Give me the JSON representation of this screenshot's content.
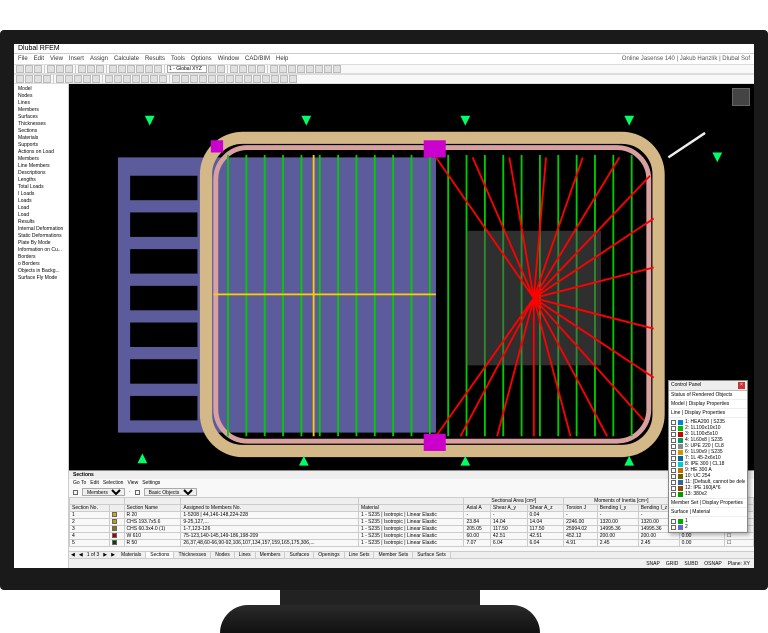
{
  "title": "Dlubal RFEM",
  "menu": [
    "File",
    "Edit",
    "View",
    "Insert",
    "Assign",
    "Calculate",
    "Results",
    "Tools",
    "Options",
    "Window",
    "CAD/BIM",
    "Help"
  ],
  "online": "Online Jasense 140 | Jakub Hanzlík | Dlubal Sof",
  "toolbar_fields": {
    "coord": "1 - Global XYZ"
  },
  "tree": {
    "items": [
      "Model",
      "Nodes",
      "Lines",
      "Members",
      "Surfaces",
      "Thicknesses",
      "Sections",
      "Materials",
      "Supports",
      "Actions on Load",
      "",
      "",
      "Members",
      "Line Members",
      "Descriptions",
      "Lengths",
      "",
      "",
      "Total Loads",
      "I Loads",
      "Loads",
      "Load",
      "Load",
      "Results",
      "Internal Deformation",
      "Static Deformations",
      "Plate By Mode",
      "",
      "",
      "",
      "Information on Cu...",
      "",
      "",
      "",
      "Borders",
      "o Borders",
      "",
      "Objects in Backg...",
      "Surface Fly Mode"
    ]
  },
  "sections_panel": {
    "title": "Sections",
    "toolbar_labels": [
      "Go To",
      "Edit",
      "Selection",
      "View",
      "Settings"
    ],
    "dropdown": "Members",
    "dropdown2": "Basic Objects",
    "group_headers": [
      "",
      "",
      "",
      "",
      "Sectional Area [cm²]",
      "",
      "Moments of Inertia [cm⁴]",
      "Principal Axis",
      ""
    ],
    "columns": [
      "Section No.",
      "",
      "Section Name",
      "Assigned to Members No.",
      "Material",
      "Axial A",
      "Shear A_y",
      "Shear A_z",
      "Torsion J",
      "Bending I_y",
      "Bending I_z",
      "α [deg]",
      "Options"
    ],
    "rows": [
      {
        "no": "1",
        "color": "#d4aa00",
        "name": "R 20",
        "assigned": "1-5208 | 44,146-148,224-228",
        "material": "1 - S235 | Isotropic | Linear Elastic",
        "A": "-",
        "Ay": "-",
        "Az": "0.04",
        "J": "-",
        "Iy": "-",
        "Iz": "-",
        "ang": "0.00",
        "opt": "☐"
      },
      {
        "no": "2",
        "color": "#c89800",
        "name": "CHS 193.7x5.6",
        "assigned": "9-25,127,...",
        "material": "1 - S235 | Isotropic | Linear Elastic",
        "A": "23.84",
        "Ay": "14.04",
        "Az": "14.04",
        "J": "2246.00",
        "Iy": "1320.00",
        "Iz": "1320.00",
        "ang": "0.00",
        "opt": "☐"
      },
      {
        "no": "3",
        "color": "#8b6f00",
        "name": "CHS 60.3x4.0 (1)",
        "assigned": "1-7,123-126",
        "material": "1 - S235 | Isotropic | Linear Elastic",
        "A": "205.05",
        "Ay": "117.50",
        "Az": "117.50",
        "J": "25994.02",
        "Iy": "14995.36",
        "Iz": "14995.36",
        "ang": "0.00",
        "opt": "☐"
      },
      {
        "no": "4",
        "color": "#aa0000",
        "name": "W 610",
        "assigned": "75-123,140-145,149-186,198-209",
        "material": "1 - S235 | Isotropic | Linear Elastic",
        "A": "60.00",
        "Ay": "42.51",
        "Az": "42.51",
        "J": "452.12",
        "Iy": "200.00",
        "Iz": "200.00",
        "ang": "0.00",
        "opt": "☐"
      },
      {
        "no": "5",
        "color": "#004400",
        "name": "R 50",
        "assigned": "26,37,48,60-66,90-92,106,107,134,157,159,165,175,306,...",
        "material": "1 - S235 | Isotropic | Linear Elastic",
        "A": "7.07",
        "Ay": "6.04",
        "Az": "6.04",
        "J": "4.91",
        "Iy": "2.45",
        "Iz": "2.45",
        "ang": "0.00",
        "opt": "☐"
      }
    ],
    "tabs_nav": [
      "◀",
      "◀",
      "1 of 3",
      "▶",
      "▶"
    ],
    "tabs": [
      "Nodes",
      "Lines",
      "Members",
      "Surfaces",
      "Openings",
      "Line Sets",
      "Member Sets",
      "Surface Sets"
    ],
    "active_tab": "Sections",
    "tabs_pre": [
      "Materials",
      "Sections",
      "Thicknesses"
    ]
  },
  "status": {
    "items": [
      "SNAP",
      "GRID",
      "SUBD",
      "OSNAP"
    ],
    "right": "Plane: XY"
  },
  "control_panel": {
    "title": "Control Panel",
    "sections": [
      {
        "label": "Status of Rendered Objects"
      },
      {
        "label": "Model | Display Properties"
      },
      {
        "label": "Line | Display Properties"
      }
    ],
    "items": [
      {
        "color": "#0088cc",
        "label": "1: HEA200 | S235"
      },
      {
        "color": "#00bb00",
        "label": "2: 1L100x10x10"
      },
      {
        "color": "#cc0000",
        "label": "3: 1L100x5x10"
      },
      {
        "color": "#009966",
        "label": "4: 1L60x8 | S235"
      },
      {
        "color": "#888888",
        "label": "5: UPE 220 | CL8"
      },
      {
        "color": "#cc9900",
        "label": "6: 1L90x9 | S235"
      },
      {
        "color": "#0066aa",
        "label": "7: 1L 45-2x6x10"
      },
      {
        "color": "#00cccc",
        "label": "8: IPE 300 | CL18"
      },
      {
        "color": "#cc6600",
        "label": "9: HE 300 A"
      },
      {
        "color": "#666600",
        "label": "10: UC 254"
      },
      {
        "color": "#336699",
        "label": "11: [Default, cannot be deleted]"
      },
      {
        "color": "#994400",
        "label": "12: IPE 160|A*6"
      },
      {
        "color": "#009900",
        "label": "13: 380x2"
      }
    ],
    "footer_sections": [
      "Member Set | Display Properties",
      "Surface | Material"
    ],
    "footer_items": [
      {
        "color": "#00aa00",
        "label": "1"
      },
      {
        "color": "#6666cc",
        "label": "2"
      }
    ]
  }
}
